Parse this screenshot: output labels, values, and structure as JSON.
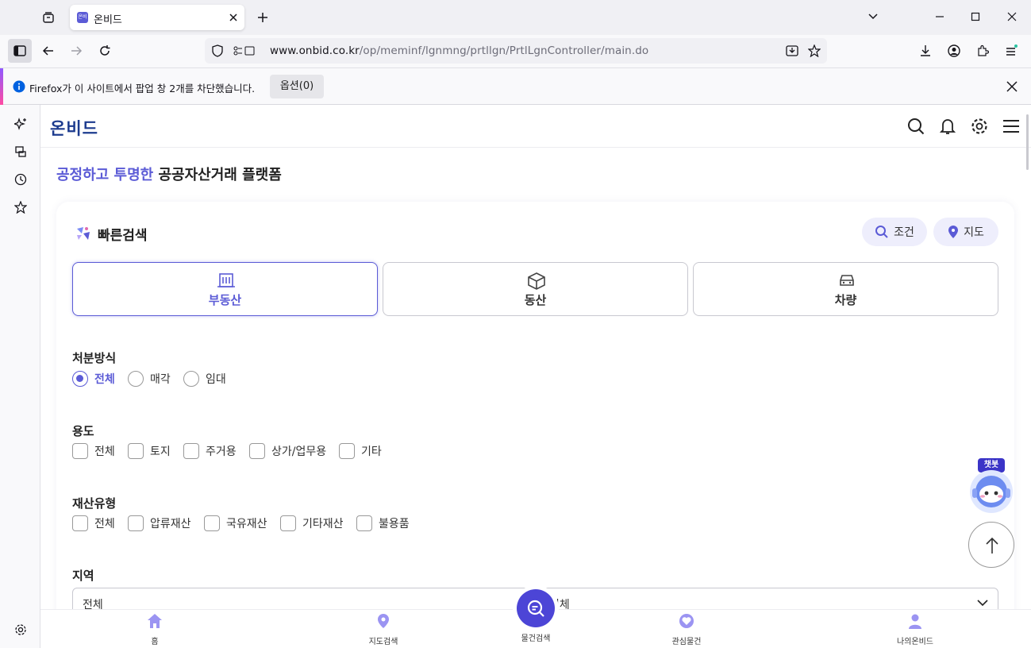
{
  "browser": {
    "tab_title": "온비드",
    "favicon_text": "온비드",
    "url_host": "www.onbid.co.kr",
    "url_path": "/op/meminf/lgnmng/prtllgn/PrtlLgnController/main.do",
    "notification": "Firefox가 이 사이트에서 팝업 창 2개를 차단했습니다.",
    "notification_button": "옵션(0)"
  },
  "site": {
    "logo": "온비드",
    "tagline_accent": "공정하고 투명한",
    "tagline_rest": " 공공자산거래 플랫폼"
  },
  "quick_search": {
    "title": "빠른검색",
    "condition_button": "조건",
    "map_button": "지도",
    "categories": [
      {
        "label": "부동산",
        "active": true
      },
      {
        "label": "동산",
        "active": false
      },
      {
        "label": "차량",
        "active": false
      }
    ]
  },
  "disposal_method": {
    "title": "처분방식",
    "options": [
      "전체",
      "매각",
      "임대"
    ],
    "selected": "전체"
  },
  "usage": {
    "title": "용도",
    "options": [
      "전체",
      "토지",
      "주거용",
      "상가/업무용",
      "기타"
    ]
  },
  "property_type": {
    "title": "재산유형",
    "options": [
      "전체",
      "압류재산",
      "국유재산",
      "기타재산",
      "불용품"
    ]
  },
  "region": {
    "title": "지역",
    "select1": "전체",
    "select2": "전체"
  },
  "chatbot_label": "챗봇",
  "bottom_nav": [
    "홈",
    "지도검색",
    "물건검색",
    "관심물건",
    "나의온비드"
  ],
  "colors": {
    "accent": "#5b5bd6",
    "logo": "#1c3b8e",
    "fab": "#4c45d6"
  }
}
